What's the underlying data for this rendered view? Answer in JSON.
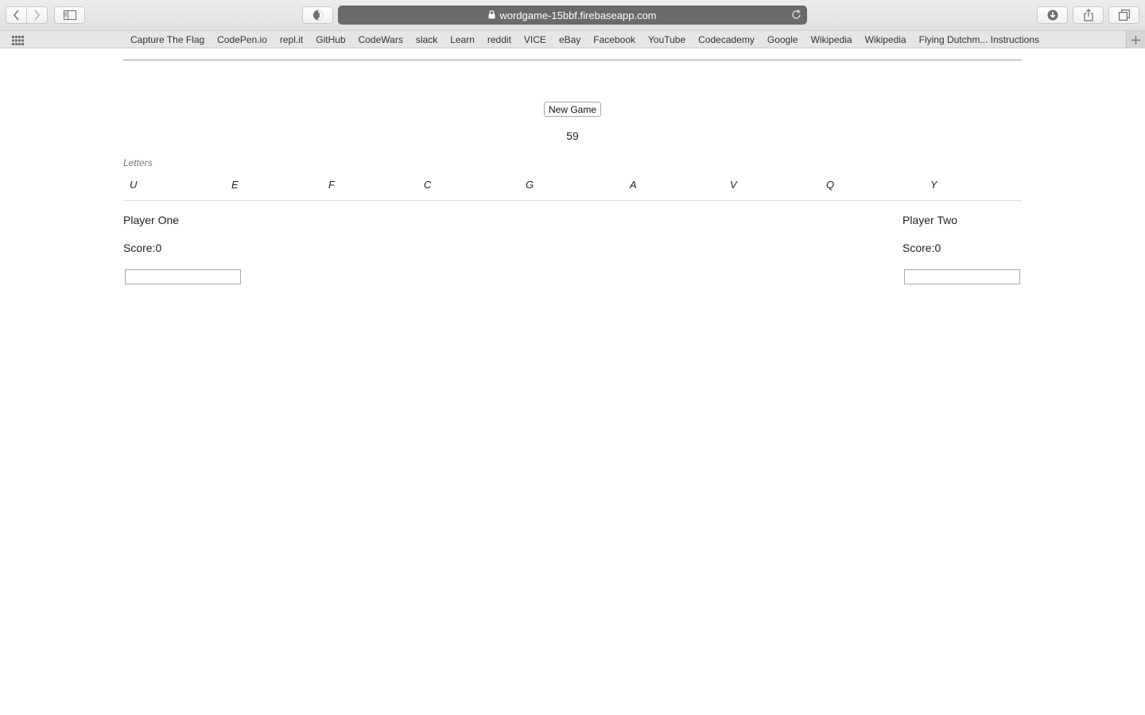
{
  "browser": {
    "url": "wordgame-15bbf.firebaseapp.com",
    "bookmarks": [
      "Capture The Flag",
      "CodePen.io",
      "repl.it",
      "GitHub",
      "CodeWars",
      "slack",
      "Learn",
      "reddit",
      "VICE",
      "eBay",
      "Facebook",
      "YouTube",
      "Codecademy",
      "Google",
      "Wikipedia",
      "Wikipedia",
      "Flying Dutchm... Instructions"
    ]
  },
  "game": {
    "new_game_label": "New Game",
    "timer": "59",
    "letters_caption": "Letters",
    "letters": [
      "U",
      "E",
      "F",
      "C",
      "G",
      "A",
      "V",
      "Q",
      "Y"
    ]
  },
  "players": [
    {
      "name": "Player One",
      "score": "Score:0",
      "input_value": ""
    },
    {
      "name": "Player Two",
      "score": "Score:0",
      "input_value": ""
    }
  ]
}
